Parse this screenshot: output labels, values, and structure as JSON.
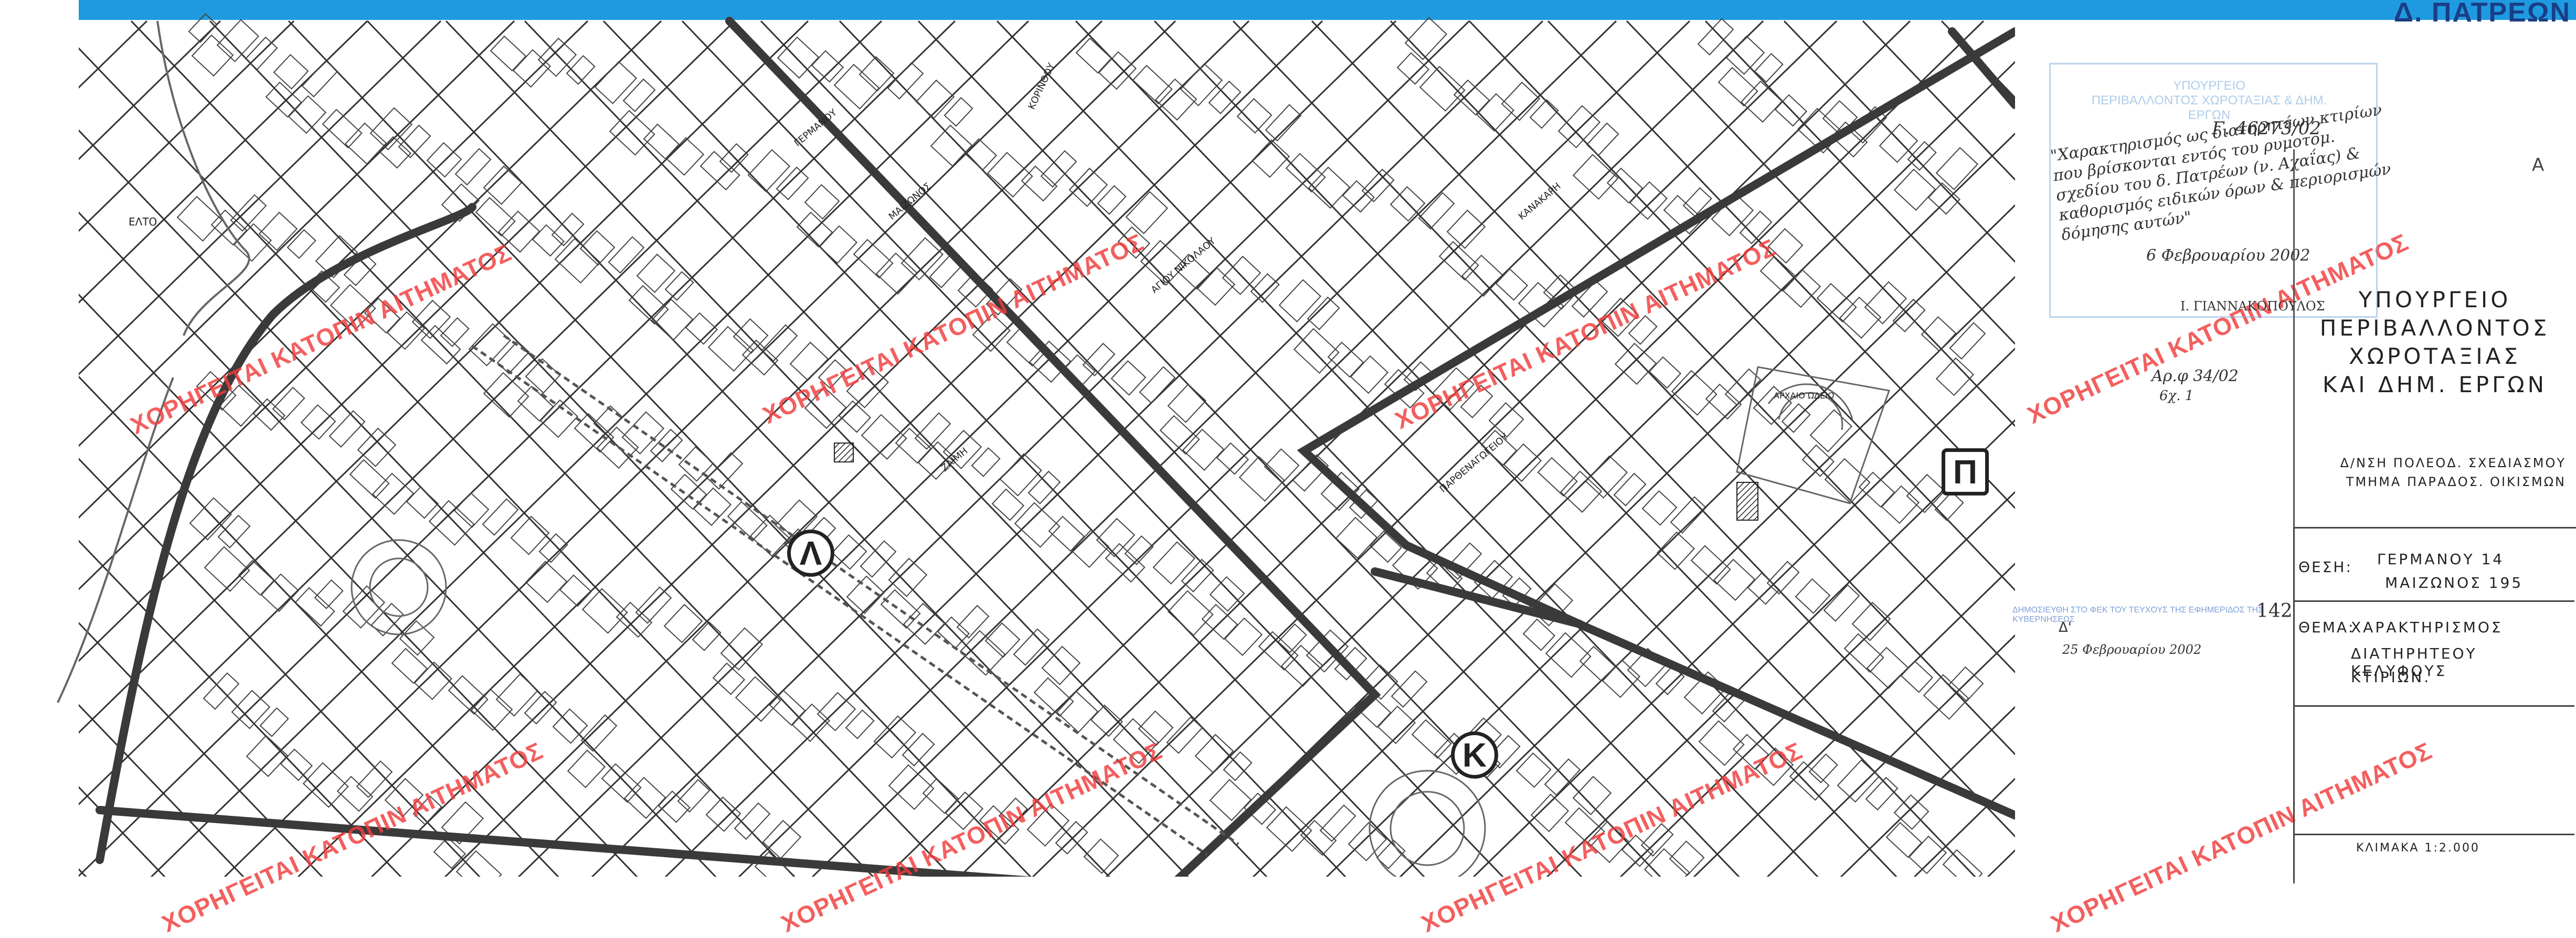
{
  "header": {
    "title": "Δ. ΠΑΤΡΕΩΝ"
  },
  "colors": {
    "banner": "#1f9ae0",
    "watermark": "#f03c3c",
    "stamp": "#78aadc",
    "ink": "#222222"
  },
  "map": {
    "zones": [
      "Λ",
      "Κ",
      "Π"
    ],
    "street_labels": [
      "ΕΛΤΟ",
      "ΓΕΡΜΑΝΟΥ",
      "ΜΑΙΖΩΝΟΣ",
      "ΚΟΡΙΝΘΟΥ",
      "ΑΓΙΟΥ ΝΙΚΟΛΑΟΥ",
      "ΚΑΝΑΚΑΡΗ",
      "ΖΑΪΜΗ",
      "ΠΑΡΘΕΝΑΓΩΓΕΙΟΥ",
      "ΑΡΧΑΙΟ ΩΔΕΙΟ"
    ]
  },
  "watermark_text": "ΧΟΡΗΓΕΙΤΑΙ ΚΑΤΟΠΙΝ ΑΙΤΗΜΑΤΟΣ",
  "stamp": {
    "lines": [
      "ΥΠΟΥΡΓΕΙΟ",
      "ΠΕΡΙΒΑΛΛΟΝΤΟΣ ΧΩΡΟΤΑΞΙΑΣ & ΔΗΜ.",
      "ΕΡΓΩΝ"
    ]
  },
  "handwritten": {
    "ref": "Γ. 46273/02",
    "description": "\"Χαρακτηρισμός ως διατηρητέων κτιρίων που βρίσκονται εντός του ρυμοτομ. σχεδίου του δ. Πατρέων (ν. Αχαΐας) & καθορισμός ειδικών όρων & περιορισμών δόμησης αυτών\"",
    "date": "6 Φεβρουαρίου 2002",
    "signer": "Ι. ΓΙΑΝΝΑΚΟΠΟΥΛΟΣ",
    "file_ref": "Αρ.φ 34/02",
    "copy": "6χ. 1"
  },
  "ministry": {
    "line1": "ΥΠΟΥΡΓΕΙΟ",
    "line2": "ΠΕΡΙΒΑΛΛΟΝΤΟΣ",
    "line3": "ΧΩΡΟΤΑΞΙΑΣ",
    "line4": "ΚΑΙ ΔΗΜ. ΕΡΓΩΝ"
  },
  "directorate": {
    "line1": "Δ/ΝΣΗ ΠΟΛΕΟΔ. ΣΧΕΔΙΑΣΜΟΥ",
    "line2": "ΤΜΗΜΑ ΠΑΡΑΔΟΣ. ΟΙΚΙΣΜΩΝ"
  },
  "title_block": {
    "location_label": "ΘΕΣΗ:",
    "location_line1": "ΓΕΡΜΑΝΟΥ 14",
    "location_line2": "ΜΑΙΖΩΝΟΣ 195",
    "subject_label": "ΘΕΜΑ:",
    "subject_line1": "ΧΑΡΑΚΤΗΡΙΣΜΟΣ",
    "subject_line2": "ΔΙΑΤΗΡΗΤΕΟΥ ΚΕΛΥΦΟΥΣ",
    "subject_line3": "ΚΤΙΡΙΩΝ."
  },
  "gazette": {
    "text": "ΔΗΜΟΣΙΕΥΘΗ ΣΤΟ ΦΕΚ ΤΟΥ ΤΕΥΧΟΥΣ ΤΗΣ ΕΦΗΜΕΡΙΔΟΣ ΤΗΣ ΚΥΒΕΡΝΗΣΕΩΣ",
    "prefix": "Δ'",
    "number": "142",
    "date": "25 Φεβρουαρίου 2002"
  },
  "scale": "ΚΛΙΜΑΚΑ 1:2.000",
  "corner_mark": "A"
}
